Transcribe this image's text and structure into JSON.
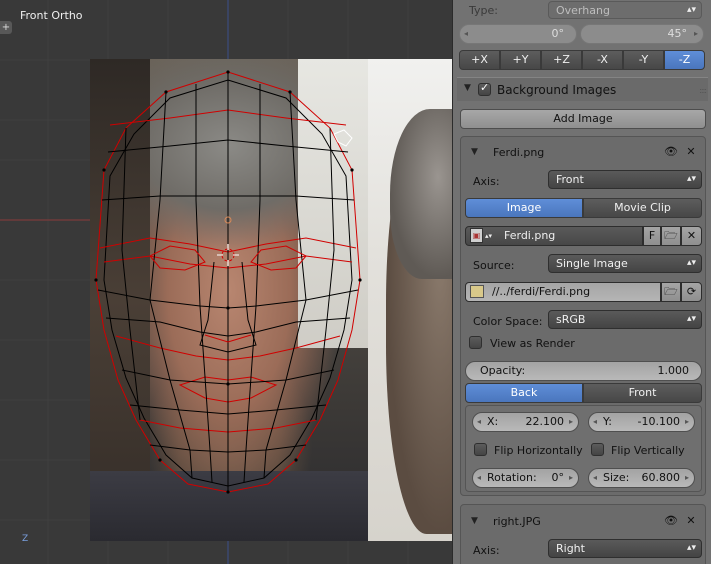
{
  "viewport": {
    "title": "Front Ortho",
    "plus_tab": "+",
    "axis_label": "Z"
  },
  "panel": {
    "type_label": "Type:",
    "type_value": "Overhang",
    "angle_left": "0°",
    "angle_right": "45°",
    "axis_buttons": [
      "+X",
      "+Y",
      "+Z",
      "-X",
      "-Y",
      "-Z"
    ],
    "axis_active": "-Z",
    "background_images": {
      "title": "Background Images",
      "add_image_label": "Add Image",
      "images": [
        {
          "name": "Ferdi.png",
          "axis_label": "Axis:",
          "axis_value": "Front",
          "type_tabs": [
            "Image",
            "Movie Clip"
          ],
          "type_active": "Image",
          "image_name": "Ferdi.png",
          "fake_user": "F",
          "source_label": "Source:",
          "source_value": "Single Image",
          "filepath": "//../ferdi/Ferdi.png",
          "color_space_label": "Color Space:",
          "color_space_value": "sRGB",
          "view_as_render": "View as Render",
          "opacity_label": "Opacity:",
          "opacity_value": "1.000",
          "order_tabs": [
            "Back",
            "Front"
          ],
          "order_active": "Back",
          "x_label": "X:",
          "x_value": "22.100",
          "y_label": "Y:",
          "y_value": "-10.100",
          "flip_h": "Flip Horizontally",
          "flip_v": "Flip Vertically",
          "rotation_label": "Rotation:",
          "rotation_value": "0°",
          "size_label": "Size:",
          "size_value": "60.800"
        },
        {
          "name": "right.JPG",
          "axis_label": "Axis:",
          "axis_value": "Right"
        }
      ]
    }
  },
  "colors": {
    "active_blue": "#5680c2",
    "panel_bg": "#727272",
    "viewport_bg": "#393939",
    "mesh_black": "#000000",
    "mesh_red": "#d00000"
  }
}
